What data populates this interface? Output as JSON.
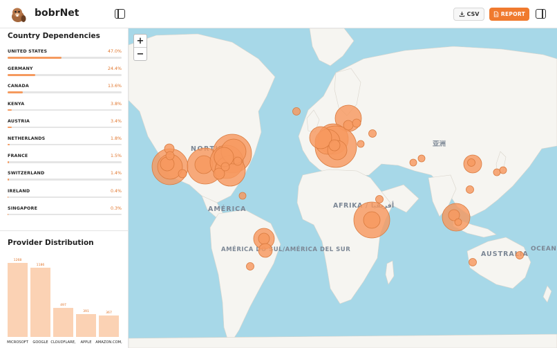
{
  "header": {
    "brand": "bobrNet",
    "csv_label": "CSV",
    "report_label": "REPORT",
    "accent": "#f07a2e"
  },
  "country_panel": {
    "title": "Country Dependencies",
    "items": [
      {
        "name": "UNITED STATES",
        "pct": "47.0%",
        "value": 0.47
      },
      {
        "name": "GERMANY",
        "pct": "24.4%",
        "value": 0.244
      },
      {
        "name": "CANADA",
        "pct": "13.6%",
        "value": 0.136
      },
      {
        "name": "KENYA",
        "pct": "3.8%",
        "value": 0.038
      },
      {
        "name": "AUSTRIA",
        "pct": "3.4%",
        "value": 0.034
      },
      {
        "name": "NETHERLANDS",
        "pct": "1.8%",
        "value": 0.018
      },
      {
        "name": "FRANCE",
        "pct": "1.5%",
        "value": 0.015
      },
      {
        "name": "SWITZERLAND",
        "pct": "1.4%",
        "value": 0.014
      },
      {
        "name": "IRELAND",
        "pct": "0.4%",
        "value": 0.004
      },
      {
        "name": "SINGAPORE",
        "pct": "0.3%",
        "value": 0.003
      }
    ]
  },
  "provider_panel": {
    "title": "Provider Distribution"
  },
  "chart_data": {
    "type": "bar",
    "categories": [
      "MICROSOFT",
      "GOOGLE",
      "CLOUDFLARE,",
      "APPLE",
      "AMAZON.COM,"
    ],
    "values": [
      1268,
      1186,
      497,
      391,
      367
    ],
    "ylim": [
      0,
      1268
    ]
  },
  "map": {
    "zoom_in": "+",
    "zoom_out": "−",
    "labels": [
      "NORTH",
      "AMÉRICA",
      "AFRIKA / أفريقيا",
      "AMÉRICA DO SUL/AMÉRICA DEL SUR",
      "亚洲",
      "AUSTRALIA",
      "OCEANI"
    ],
    "land_color": "#f6f5f1",
    "water_color": "#a7d8e8",
    "marker_color": "#f6985f"
  }
}
